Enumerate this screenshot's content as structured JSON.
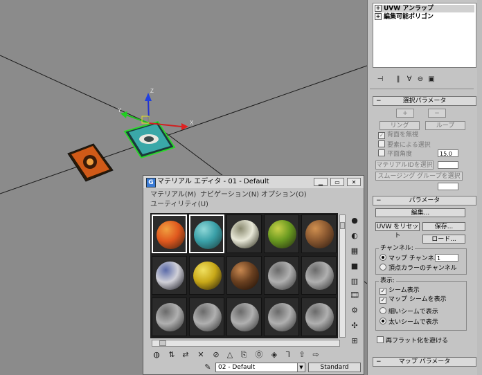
{
  "command_panel": {
    "modifier_stack": [
      {
        "label": "UVW アンラップ",
        "expand": "+",
        "selected": true
      },
      {
        "label": "編集可能ポリゴン",
        "expand": "+",
        "selected": false
      }
    ],
    "rollout_select_params": "選択パラメータ",
    "plus_btn": "+",
    "minus_btn": "−",
    "ring_btn": "リング",
    "loop_btn": "ループ",
    "ignore_backface": "背面を無視",
    "select_by_element": "要素による選択",
    "planar_angle": "平面角度",
    "planar_angle_value": "15.0",
    "select_mat_id": "マテリアルIDを選択",
    "select_smoothing": "スムージング グループを選択",
    "rollout_params": "パラメータ",
    "edit_btn": "編集...",
    "reset_uvw_btn": "UVW をリセット",
    "save_btn": "保存...",
    "load_btn": "ロード...",
    "channel_group": "チャンネル:",
    "map_channel": "マップ チャンネル",
    "map_channel_value": "1",
    "vertex_color_channel": "頂点カラーのチャンネル",
    "display_group": "表示:",
    "show_seams": "シーム表示",
    "show_map_seams": "マップ シームを表示",
    "thin_seams": "細いシームで表示",
    "thick_seams": "太いシームで表示",
    "prevent_reflatten": "再フラット化を避ける",
    "rollout_map_params": "マップ パラメータ"
  },
  "material_editor": {
    "title": "マテリアル エディタ - 01 - Default",
    "title_icon": "3ds-max-icon",
    "menus": [
      "マテリアル(M)",
      "ナビゲーション(N)",
      "オプション(O)",
      "ユーティリティ(U)"
    ],
    "material_name": "02 - Default",
    "material_type": "Standard",
    "slots": [
      {
        "colors": [
          "#e0581e",
          "#f0a040",
          "#3a2010"
        ],
        "active": true
      },
      {
        "colors": [
          "#3aa0a8",
          "#8fd8d8",
          "#1a3a3a"
        ],
        "active": true
      },
      {
        "colors": [
          "#e8e8d8",
          "#8a8a70",
          "#202010"
        ],
        "active": false
      },
      {
        "colors": [
          "#6a9a20",
          "#c8d048",
          "#202810"
        ],
        "active": false
      },
      {
        "colors": [
          "#8a5830",
          "#d09050",
          "#2a1a10"
        ],
        "active": false
      },
      {
        "colors": [
          "#d0d0d8",
          "#5a6aa8",
          "#101018"
        ],
        "active": false
      },
      {
        "colors": [
          "#c8a818",
          "#f0e060",
          "#201808"
        ],
        "active": false
      },
      {
        "colors": [
          "#6a4020",
          "#c88850",
          "#1a0c04"
        ],
        "active": false
      },
      {
        "colors": [
          "#b0b0b0",
          "#6a6a6a",
          "#2a2a2a"
        ],
        "active": false
      },
      {
        "colors": [
          "#b0b0b0",
          "#6a6a6a",
          "#2a2a2a"
        ],
        "active": false
      },
      {
        "colors": [
          "#b0b0b0",
          "#6a6a6a",
          "#2a2a2a"
        ],
        "active": false
      },
      {
        "colors": [
          "#b0b0b0",
          "#6a6a6a",
          "#2a2a2a"
        ],
        "active": false
      },
      {
        "colors": [
          "#b0b0b0",
          "#6a6a6a",
          "#2a2a2a"
        ],
        "active": false
      },
      {
        "colors": [
          "#b0b0b0",
          "#6a6a6a",
          "#2a2a2a"
        ],
        "active": false
      },
      {
        "colors": [
          "#b0b0b0",
          "#6a6a6a",
          "#2a2a2a"
        ],
        "active": false
      }
    ]
  }
}
